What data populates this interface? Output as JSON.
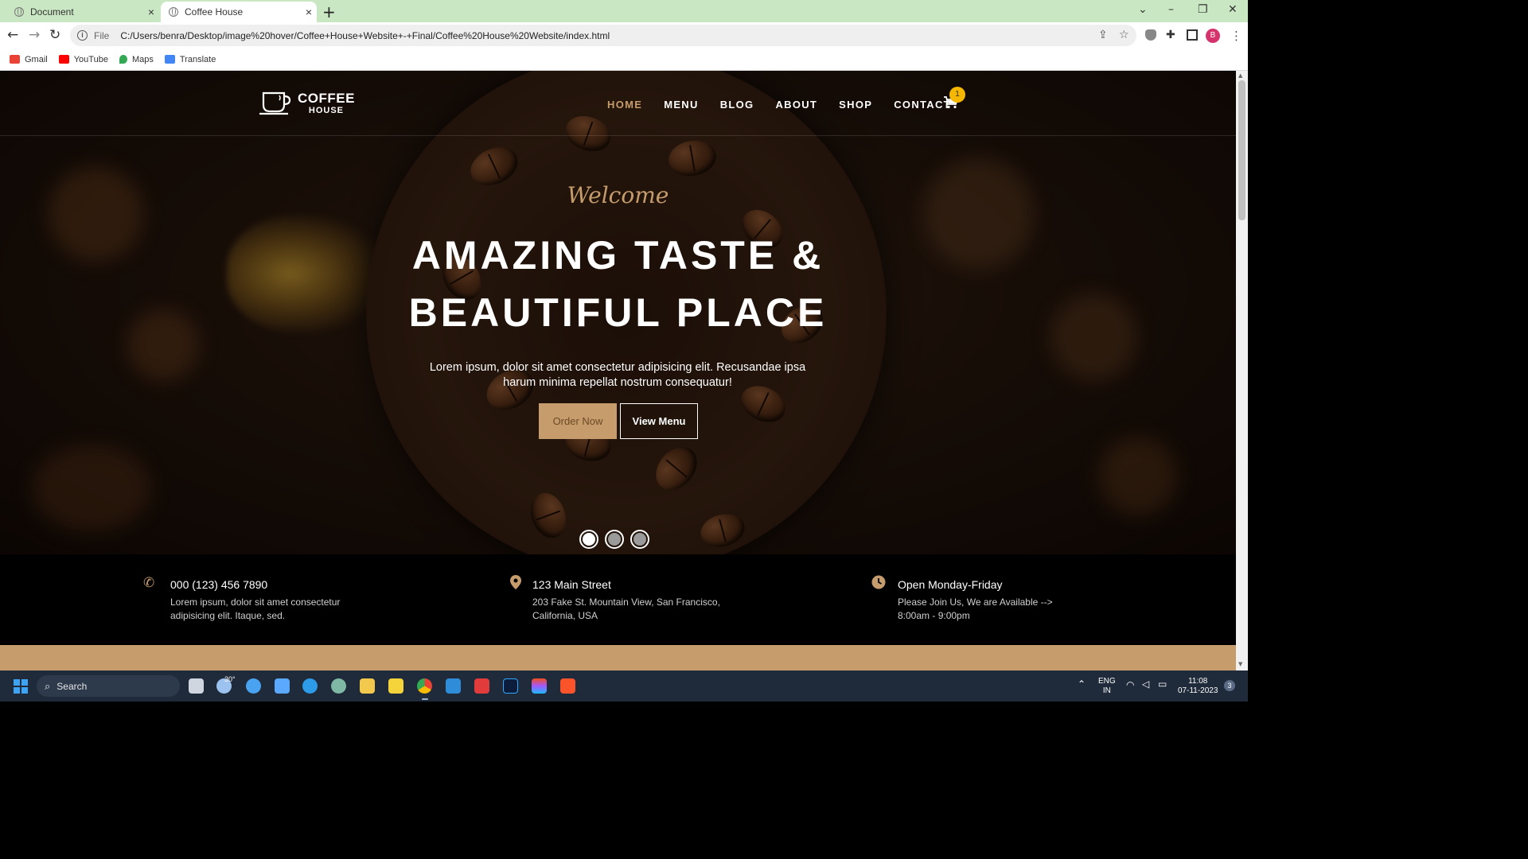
{
  "browser": {
    "tabs": [
      {
        "label": "Document",
        "close": "×"
      },
      {
        "label": "Coffee House",
        "close": "×"
      }
    ],
    "new_tab": "+",
    "window_controls": [
      "⌄",
      "–",
      "❐",
      "✕"
    ],
    "nav": {
      "back": "←",
      "forward": "→",
      "reload": "↻"
    },
    "address": {
      "scheme": "File",
      "url": "C:/Users/benra/Desktop/image%20hover/Coffee+House+Website+-+Final/Coffee%20House%20Website/index.html"
    },
    "profile_initial": "B",
    "bookmarks": [
      {
        "label": "Gmail",
        "icon": "gmail-icon",
        "color": "#ea4335"
      },
      {
        "label": "YouTube",
        "icon": "youtube-icon",
        "color": "#ff0000"
      },
      {
        "label": "Maps",
        "icon": "maps-icon",
        "color": "#34a853"
      },
      {
        "label": "Translate",
        "icon": "translate-icon",
        "color": "#4285f4"
      }
    ]
  },
  "site": {
    "logo": {
      "line1": "COFFEE",
      "line2": "HOUSE"
    },
    "nav": [
      "HOME",
      "MENU",
      "BLOG",
      "ABOUT",
      "SHOP",
      "CONTACT"
    ],
    "active_nav": "HOME",
    "cart_count": "1",
    "hero": {
      "welcome": "Welcome",
      "headline_line1": "AMAZING TASTE &",
      "headline_line2": "BEAUTIFUL PLACE",
      "lead": "Lorem ipsum, dolor sit amet consectetur adipisicing elit. Recusandae ipsa harum minima repellat nostrum consequatur!",
      "primary_button": "Order Now",
      "secondary_button": "View Menu",
      "slides": 3,
      "active_slide": 1
    },
    "info": [
      {
        "icon": "phone-icon",
        "title": "000 (123) 456 7890",
        "text": "Lorem ipsum, dolor sit amet consectetur adipisicing elit. Itaque, sed."
      },
      {
        "icon": "map-pin-icon",
        "title": "123 Main Street",
        "text": "203 Fake St. Mountain View, San Francisco, California, USA"
      },
      {
        "icon": "clock-icon",
        "title": "Open Monday-Friday",
        "text": "Please Join Us, We are Available -->\n8:00am - 9:00pm"
      }
    ],
    "colors": {
      "accent": "#c69c6d",
      "badge": "#f5b700"
    }
  },
  "taskbar": {
    "search_placeholder": "Search",
    "weather": "30°",
    "language_line1": "ENG",
    "language_line2": "IN",
    "time": "11:08",
    "date": "07-11-2023",
    "notifications": "3"
  }
}
